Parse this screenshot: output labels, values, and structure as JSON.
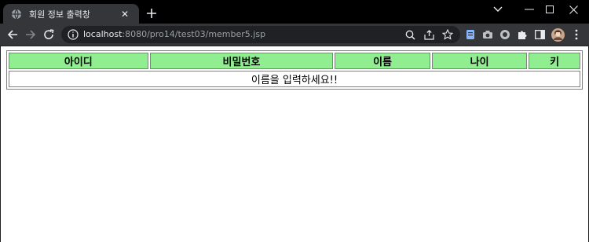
{
  "browser": {
    "tab": {
      "title": "회원 정보 출력창",
      "close_glyph": "✕"
    },
    "new_tab_glyph": "+",
    "window_controls": {
      "minimize": "—",
      "maximize": "☐",
      "close": "✕",
      "dropdown": "⌄"
    },
    "address": {
      "host": "localhost",
      "path": ":8080/pro14/test03/member5.jsp"
    },
    "colors": {
      "chrome_dark": "#35363a",
      "titlebar": "#000000",
      "omnibox": "#202124"
    }
  },
  "page": {
    "table": {
      "headers": [
        "아이디",
        "비밀번호",
        "이름",
        "나이",
        "키"
      ],
      "message": "이름을 입력하세요!!",
      "header_bg": "#90ee90"
    }
  }
}
